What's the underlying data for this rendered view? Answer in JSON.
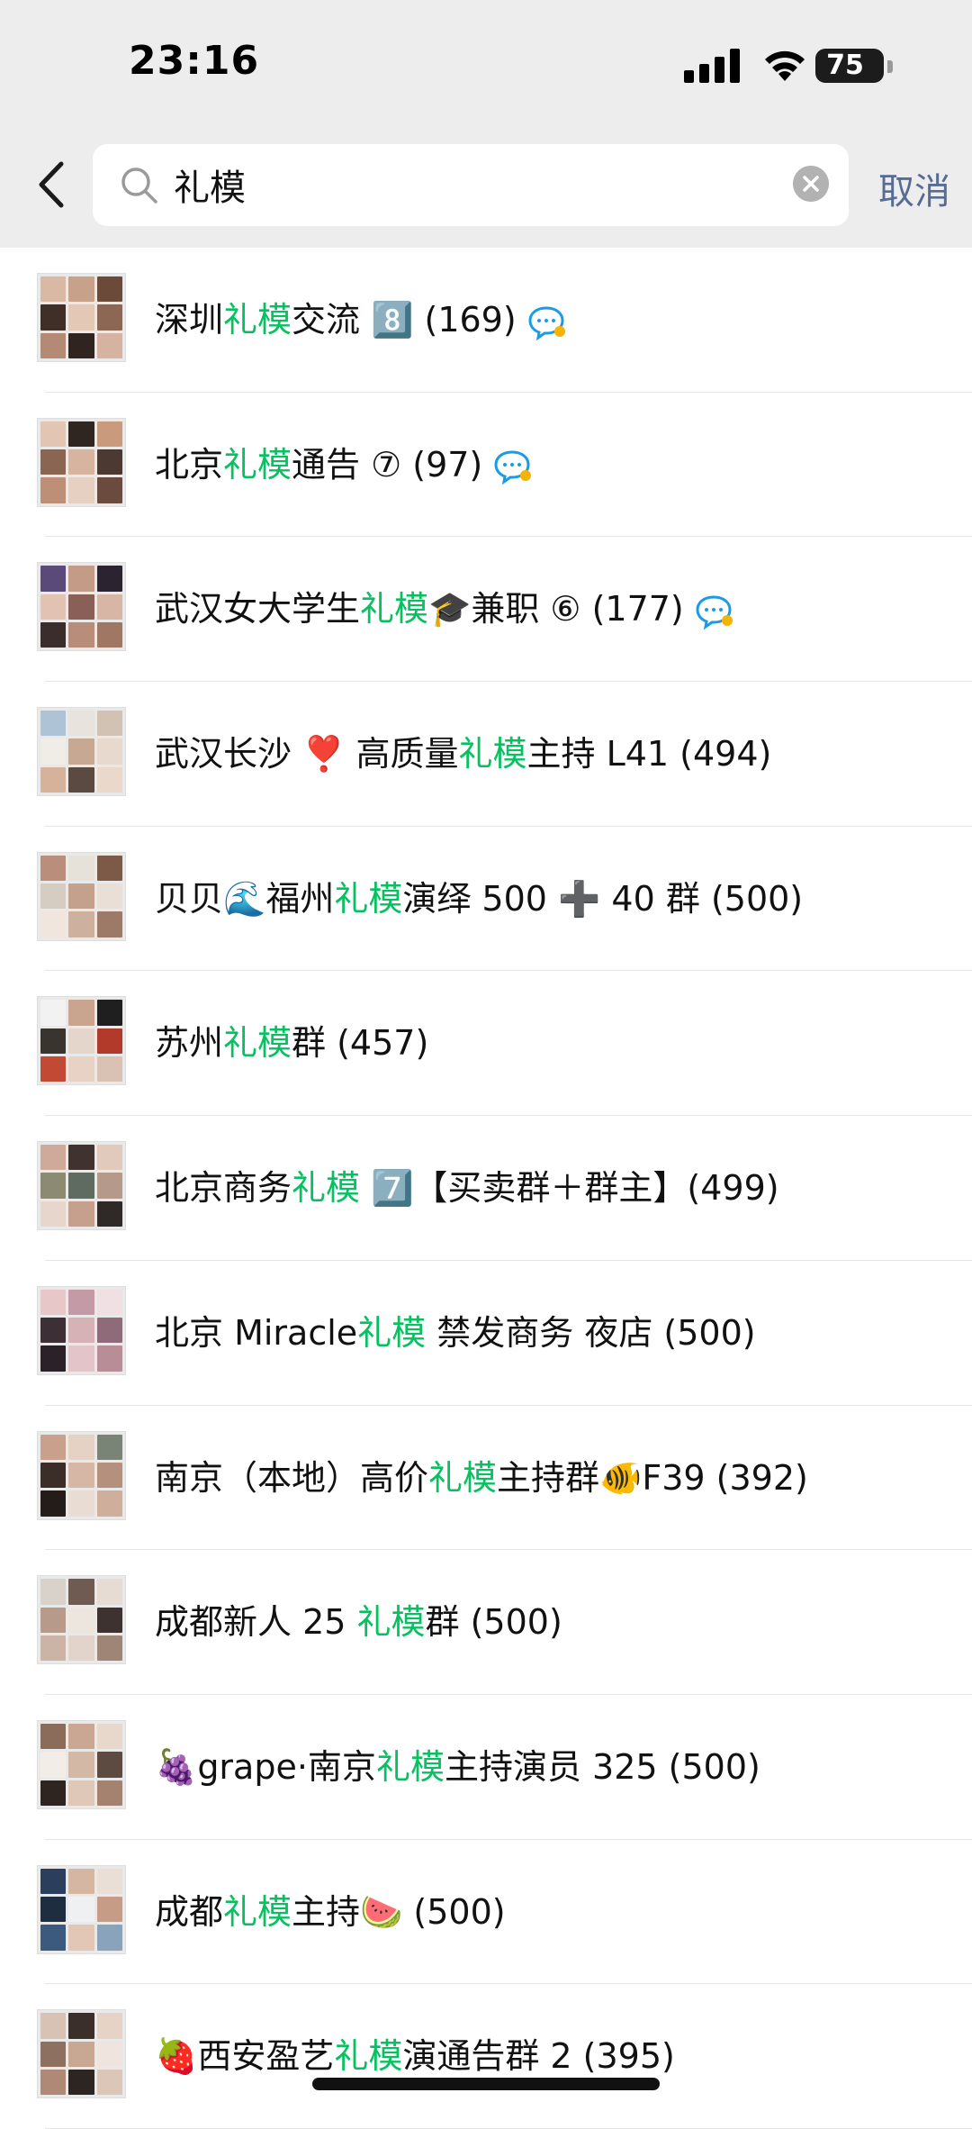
{
  "status_bar": {
    "time": "23:16",
    "battery": "75"
  },
  "search": {
    "query": "礼模",
    "cancel_label": "取消"
  },
  "results": [
    {
      "pre": "深圳",
      "hl": "礼模",
      "post": "交流 8️⃣ (169)",
      "chat_icon": true,
      "avatar_colors": [
        "#d9b9a3",
        "#c7a18a",
        "#6b4a3a",
        "#3f2f27",
        "#e3c8b6",
        "#8c6754",
        "#b48a74",
        "#2f2420",
        "#d6b3a0"
      ]
    },
    {
      "pre": "北京",
      "hl": "礼模",
      "post": "通告 ⑦ (97)",
      "chat_icon": true,
      "avatar_colors": [
        "#e3c5b3",
        "#2f2622",
        "#c99a7c",
        "#8a6652",
        "#d7b4a0",
        "#4c3a32",
        "#bd8f76",
        "#e6d0c2",
        "#6a4b3d"
      ]
    },
    {
      "pre": "武汉女大学生",
      "hl": "礼模",
      "post": "🎓兼职 ⑥ (177)",
      "chat_icon": true,
      "avatar_colors": [
        "#5a4a7a",
        "#c49b86",
        "#2c2330",
        "#e1c2b3",
        "#8a5f57",
        "#d8b6a5",
        "#3b2d2c",
        "#b88d7a",
        "#a07762"
      ]
    },
    {
      "pre": "武汉长沙 ❣️ 高质量",
      "hl": "礼模",
      "post": "主持 L41 (494)",
      "chat_icon": false,
      "avatar_colors": [
        "#aec4d6",
        "#e8e3dc",
        "#d2c2b4",
        "#f0ece6",
        "#c6a893",
        "#e7d9cd",
        "#d7b29b",
        "#5b4a42",
        "#ead8ca"
      ]
    },
    {
      "pre": "贝贝🌊福州",
      "hl": "礼模",
      "post": "演绎 500 ➕ 40 群 (500)",
      "chat_icon": false,
      "avatar_colors": [
        "#b98f7c",
        "#e6e1d9",
        "#7d5a48",
        "#d5ccc2",
        "#c3a18c",
        "#e9dfd6",
        "#f0e6de",
        "#cdb19e",
        "#9d7967"
      ]
    },
    {
      "pre": "苏州",
      "hl": "礼模",
      "post": "群 (457)",
      "chat_icon": false,
      "avatar_colors": [
        "#f2f2f2",
        "#c9a48f",
        "#1f1f1f",
        "#3a342f",
        "#e4d6cb",
        "#b23a2a",
        "#c24a35",
        "#e8d2c6",
        "#d9c2b3"
      ]
    },
    {
      "pre": "北京商务",
      "hl": "礼模",
      "post": " 7️⃣【买卖群＋群主】(499)",
      "chat_icon": false,
      "avatar_colors": [
        "#cfa99a",
        "#40332f",
        "#e1c9bc",
        "#8d8a73",
        "#5f6a61",
        "#b59a8b",
        "#e6d6cc",
        "#c79f8d",
        "#2f2a28"
      ]
    },
    {
      "pre": "北京 Miracle",
      "hl": "礼模",
      "post": " 禁发商务 夜店 (500)",
      "chat_icon": false,
      "avatar_colors": [
        "#e7c7c7",
        "#c59aa7",
        "#f0e0e4",
        "#3c2f35",
        "#d6b2b7",
        "#8f6a78",
        "#2a2228",
        "#e2c4c9",
        "#b98d98"
      ]
    },
    {
      "pre": "南京（本地）高价",
      "hl": "礼模",
      "post": "主持群🐠F39 (392)",
      "chat_icon": false,
      "avatar_colors": [
        "#c8a08c",
        "#e6d2c5",
        "#7a8476",
        "#3b2e29",
        "#d6b7a6",
        "#b4907d",
        "#231c19",
        "#e8dcd3",
        "#cfae9c"
      ]
    },
    {
      "pre": "成都新人 25 ",
      "hl": "礼模",
      "post": "群 (500)",
      "chat_icon": false,
      "avatar_colors": [
        "#d8d2cb",
        "#6f5b52",
        "#e7dcd3",
        "#b79a8a",
        "#ede6df",
        "#3d3230",
        "#cbb3a5",
        "#e2d4ca",
        "#9f8576"
      ]
    },
    {
      "pre": "🍇grape·南京",
      "hl": "礼模",
      "post": "主持演员 325 (500)",
      "chat_icon": false,
      "avatar_colors": [
        "#8b6b5a",
        "#c9a792",
        "#e8d8cc",
        "#f3ede8",
        "#d4b8a6",
        "#5d4a40",
        "#2e2420",
        "#e0c8b8",
        "#a4826f"
      ]
    },
    {
      "pre": "成都",
      "hl": "礼模",
      "post": "主持🍉 (500)",
      "chat_icon": false,
      "avatar_colors": [
        "#2b3f5c",
        "#d4b6a2",
        "#e9dfd6",
        "#1f2d40",
        "#eef0f2",
        "#c79c86",
        "#3b5a7d",
        "#e2c7b6",
        "#8aa3bd"
      ]
    },
    {
      "pre": "🍓西安盈艺",
      "hl": "礼模",
      "post": "演通告群 2 (395)",
      "chat_icon": false,
      "avatar_colors": [
        "#d8c2b4",
        "#3a2f2b",
        "#e6d3c6",
        "#8e7060",
        "#c9a893",
        "#efe5de",
        "#b08976",
        "#2d2522",
        "#dcc6b8"
      ]
    }
  ]
}
